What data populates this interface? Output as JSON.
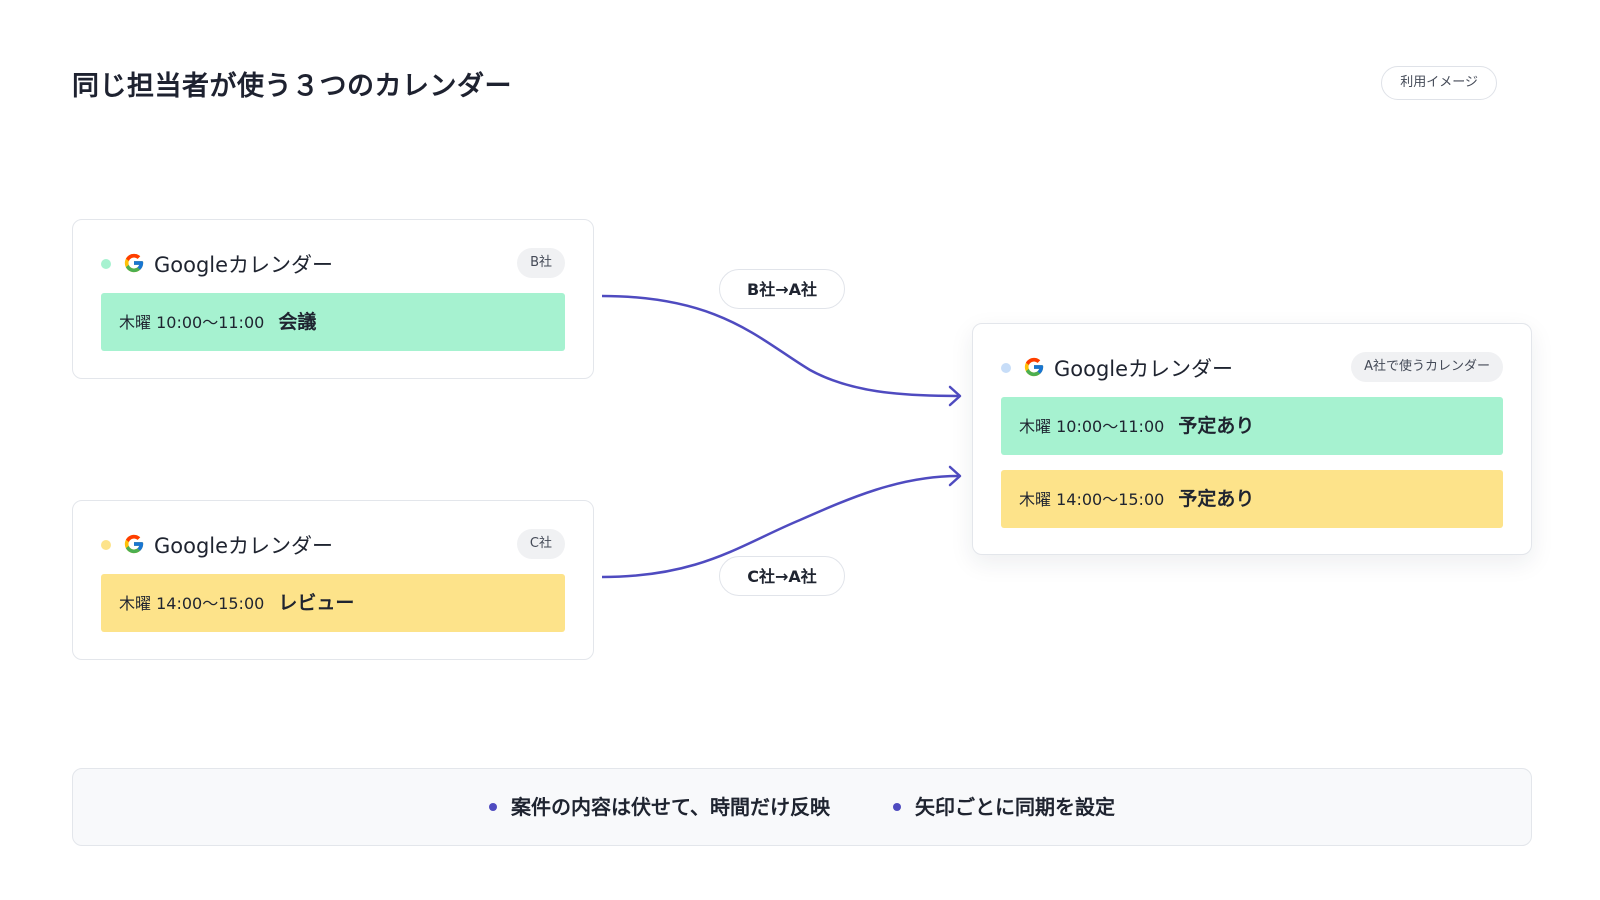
{
  "title": "同じ担当者が使う３つのカレンダー",
  "badge": "利用イメージ",
  "colors": {
    "accent": "#4f4bc0",
    "event_green": "#a6f2d0",
    "event_yellow": "#fde38a",
    "dot_green": "#a6f2d0",
    "dot_yellow": "#fde38a",
    "dot_blue": "#c7ddf8"
  },
  "cards": {
    "b": {
      "app": "Googleカレンダー",
      "tag": "B社",
      "icon": "google-g-icon",
      "events": [
        {
          "time": "木曜 10:00〜11:00",
          "title": "会議"
        }
      ]
    },
    "c": {
      "app": "Googleカレンダー",
      "tag": "C社",
      "icon": "google-g-icon",
      "events": [
        {
          "time": "木曜 14:00〜15:00",
          "title": "レビュー"
        }
      ]
    },
    "a": {
      "app": "Googleカレンダー",
      "tag": "A社で使うカレンダー",
      "icon": "google-g-icon",
      "events": [
        {
          "time": "木曜 10:00〜11:00",
          "title": "予定あり"
        },
        {
          "time": "木曜 14:00〜15:00",
          "title": "予定あり"
        }
      ]
    }
  },
  "arrows": [
    {
      "label": "B社→A社",
      "from": "B社",
      "to": "A社"
    },
    {
      "label": "C社→A社",
      "from": "C社",
      "to": "A社"
    }
  ],
  "footer": {
    "notes": [
      "案件の内容は伏せて、時間だけ反映",
      "矢印ごとに同期を設定"
    ]
  }
}
